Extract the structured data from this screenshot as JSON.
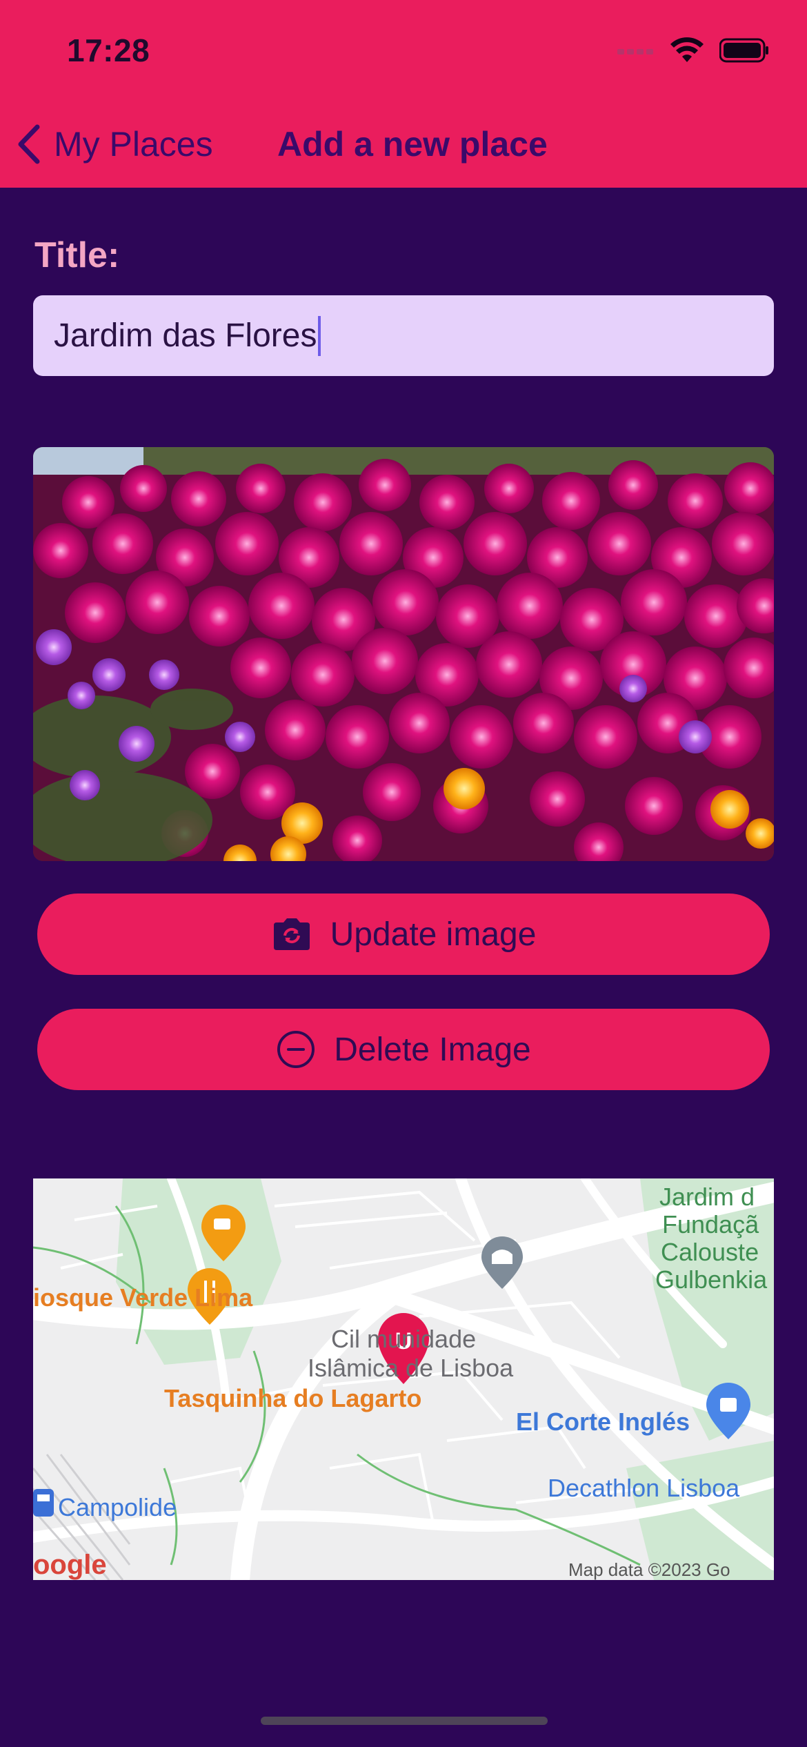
{
  "status_bar": {
    "time": "17:28"
  },
  "nav": {
    "back_label": "My Places",
    "title": "Add a new place"
  },
  "form": {
    "title_label": "Title:",
    "title_value": "Jardim das Flores"
  },
  "image": {
    "icon": "flower-photo"
  },
  "buttons": {
    "update_label": "Update image",
    "update_icon": "camera-rotate-icon",
    "delete_label": "Delete Image",
    "delete_icon": "minus-circle-icon"
  },
  "map": {
    "marker_letter": "U",
    "labels": {
      "kiosk": "iosque Verde Lima",
      "tasquinha": "Tasquinha do Lagarto",
      "comunidade_1": "Cil   munidade",
      "comunidade_2": "Islâmica de Lisboa",
      "corte_ingles": "El Corte Inglés",
      "decathlon": "Decathlon Lisboa",
      "campolide": "Campolide",
      "gulbenkian_1": "Jardim d",
      "gulbenkian_2": "Fundaçã",
      "gulbenkian_3": "Calouste",
      "gulbenkian_4": "Gulbenkia",
      "attribution": "Map data ©2023 Go",
      "google": "oogle"
    }
  },
  "colors": {
    "accent": "#ea1d5d",
    "background": "#2d0657",
    "input_bg": "#e6d1fb",
    "label": "#f4a6c4"
  }
}
